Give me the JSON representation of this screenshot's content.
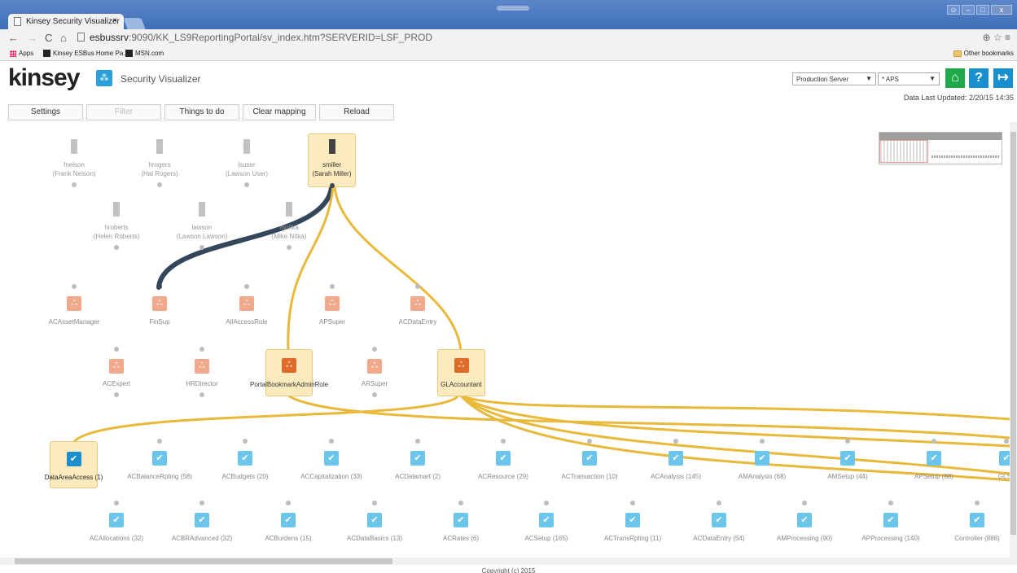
{
  "browser": {
    "tab_title": "Kinsey Security Visualizer",
    "tab_close": "×",
    "url_host": "esbussrv",
    "url_path": ":9090/KK_LS9ReportingPortal/sv_index.htm?SERVERID=LSF_PROD",
    "bookmarks": [
      "Apps",
      "Kinsey ESBus Home Pa...",
      "MSN.com"
    ],
    "other_bookmarks": "Other bookmarks"
  },
  "app": {
    "logo": "kinsey",
    "title": "Security Visualizer",
    "server_select": "Production Server",
    "app_select": "* APS",
    "help_label": "?",
    "last_updated": "Data Last Updated: 2/20/15 14:35",
    "colors": {
      "accent": "#1a8fd0",
      "home": "#1eaa4a",
      "highlight": "#fdebc0",
      "edge_active": "#e8b93a",
      "edge_dark": "#34475a"
    }
  },
  "toolbar": {
    "settings": "Settings",
    "filter": "Filter",
    "things_to_do": "Things to do",
    "clear_mapping": "Clear mapping",
    "reload": "Reload"
  },
  "users": [
    {
      "id": "fnelson",
      "name": "(Frank Nelson)"
    },
    {
      "id": "hrogers",
      "name": "(Hal Rogers)"
    },
    {
      "id": "lsuser",
      "name": "(Lawson User)"
    },
    {
      "id": "smiller",
      "name": "(Sarah Miller)"
    },
    {
      "id": "hroberts",
      "name": "(Helen Roberts)"
    },
    {
      "id": "lawson",
      "name": "(Lawson Lawson)"
    },
    {
      "id": "mnitka",
      "name": "(Mike Nitka)"
    }
  ],
  "roles": [
    "ACAssetManager",
    "FinSup",
    "AllAccessRole",
    "APSuper",
    "ACDataEntry",
    "ACExpert",
    "HRDirector",
    "PortalBookmarkAdminRole",
    "ARSuper",
    "GLAccountant"
  ],
  "groups_row1": [
    "DataAreaAccess (1)",
    "ACBalanceRpting (58)",
    "ACBudgets (20)",
    "ACCapitalization (33)",
    "ACDatamart (2)",
    "ACResource (29)",
    "ACTransaction (10)",
    "ACAnalysis (145)",
    "AMAnalysis (68)",
    "AMSetup (44)",
    "APSetup (68)",
    "GLSe"
  ],
  "groups_row2": [
    "ACAllocations (32)",
    "ACBRAdvanced (32)",
    "ACBurdens (15)",
    "ACDataBasics (13)",
    "ACRates (6)",
    "ACSetup (165)",
    "ACTransRpting (11)",
    "ACDataEntry (54)",
    "AMProcessing (90)",
    "APProcessing (140)",
    "Controller (888)"
  ],
  "footer": "Copyright (c) 2015"
}
